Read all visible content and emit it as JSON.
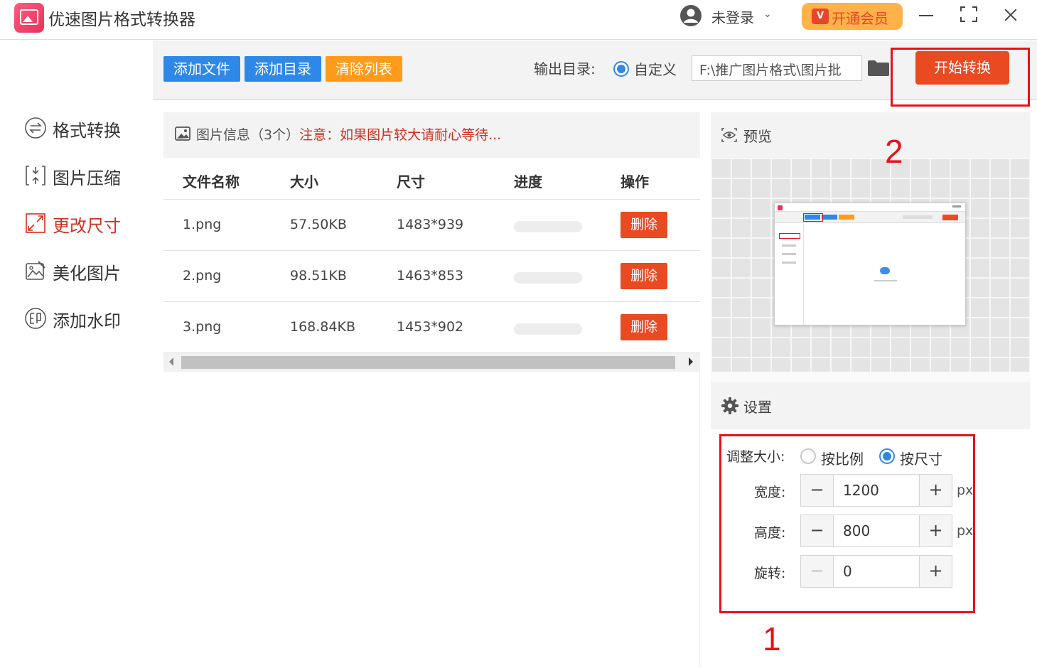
{
  "app": {
    "title": "优速图片格式转换器"
  },
  "header": {
    "user_label": "未登录",
    "vip_badge": "V",
    "vip_label": "开通会员"
  },
  "sidebar": {
    "items": [
      {
        "label": "格式转换",
        "icon": "format-convert-icon"
      },
      {
        "label": "图片压缩",
        "icon": "compress-icon"
      },
      {
        "label": "更改尺寸",
        "icon": "resize-icon",
        "active": true
      },
      {
        "label": "美化图片",
        "icon": "beautify-icon"
      },
      {
        "label": "添加水印",
        "icon": "watermark-icon"
      }
    ]
  },
  "toolbar": {
    "add_file": "添加文件",
    "add_dir": "添加目录",
    "clear_list": "清除列表",
    "output_label": "输出目录:",
    "custom_option": "自定义",
    "output_path": "F:\\推广图片格式\\图片批",
    "start_button": "开始转换"
  },
  "filelist": {
    "title": "图片信息（3个）",
    "warning": "注意：如果图片较大请耐心等待...",
    "columns": [
      "文件名称",
      "大小",
      "尺寸",
      "进度",
      "操作"
    ],
    "rows": [
      {
        "name": "1.png",
        "size": "57.50KB",
        "dims": "1483*939",
        "progress": 0,
        "action": "删除"
      },
      {
        "name": "2.png",
        "size": "98.51KB",
        "dims": "1463*853",
        "progress": 0,
        "action": "删除"
      },
      {
        "name": "3.png",
        "size": "168.84KB",
        "dims": "1453*902",
        "progress": 0,
        "action": "删除"
      }
    ]
  },
  "preview": {
    "title": "预览"
  },
  "settings": {
    "title": "设置",
    "resize_label": "调整大小:",
    "option_ratio": "按比例",
    "option_size": "按尺寸",
    "selected": "按尺寸",
    "width_label": "宽度:",
    "width_value": "1200",
    "height_label": "高度:",
    "height_value": "800",
    "rotate_label": "旋转:",
    "rotate_value": "0",
    "unit": "px",
    "minus": "−",
    "plus": "+"
  },
  "annotations": {
    "one": "1",
    "two": "2"
  },
  "colors": {
    "accent_blue": "#2e88e8",
    "accent_orange": "#ff9b1a",
    "danger": "#ea4a22",
    "annotation_red": "#e8111a"
  }
}
